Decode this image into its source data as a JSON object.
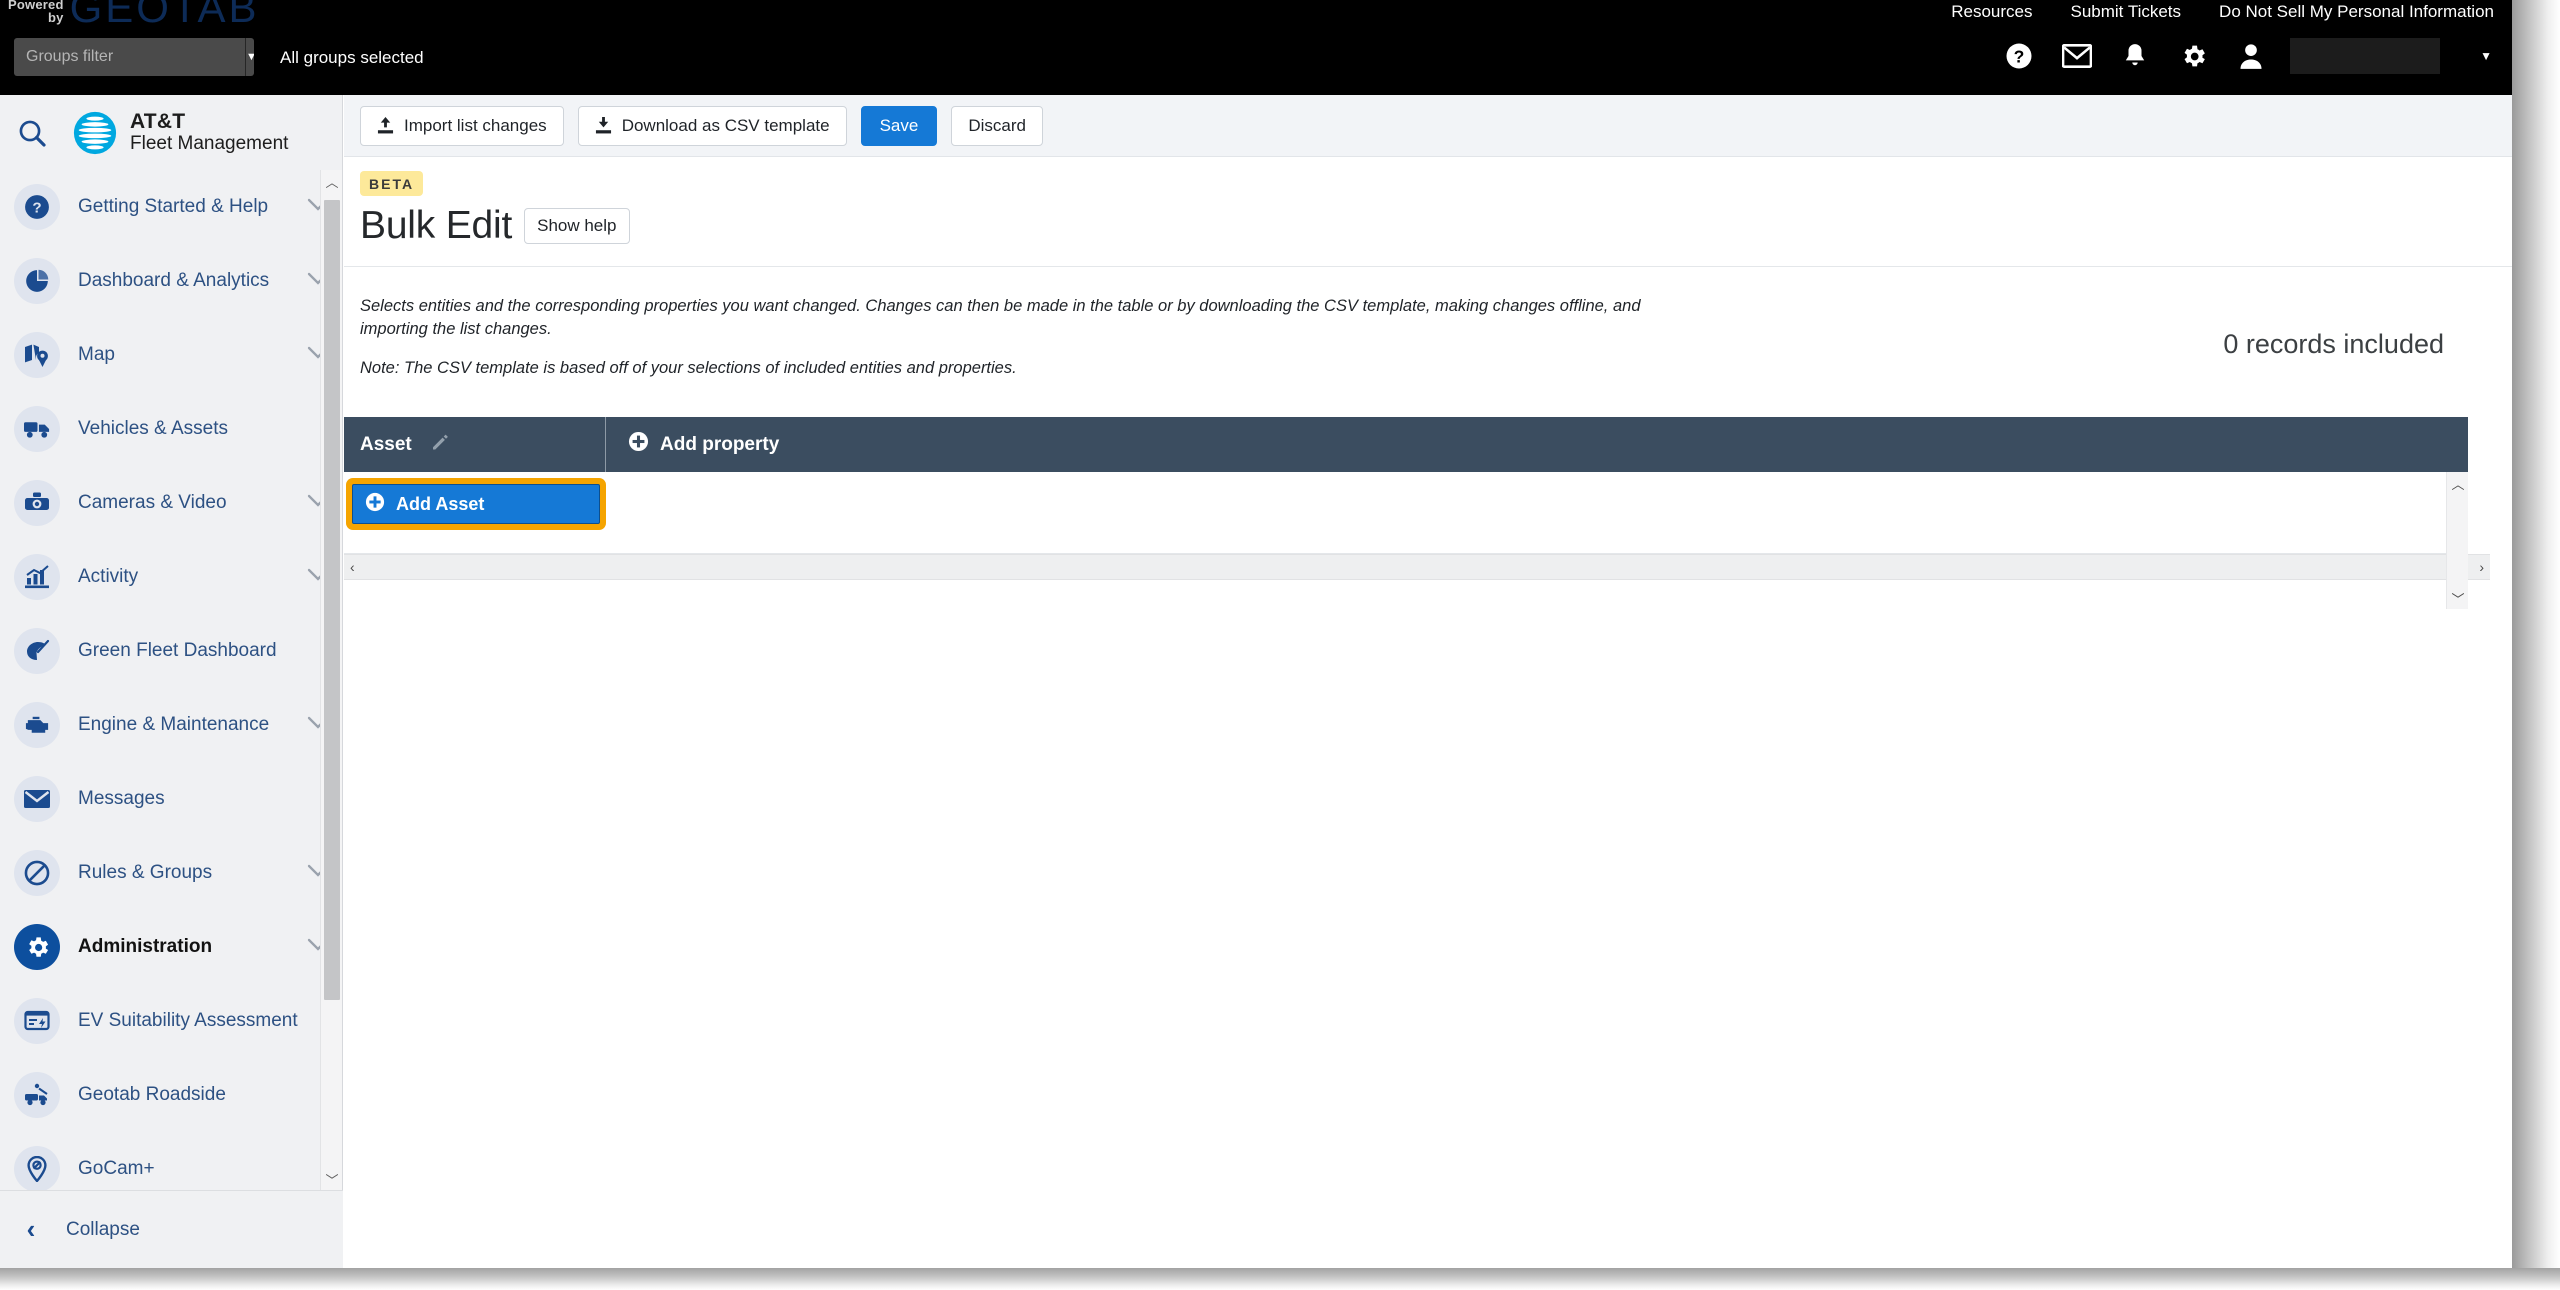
{
  "topbar": {
    "powered_by_line1": "Powered",
    "powered_by_line2": "by",
    "brand": "GEOTAB",
    "links": [
      {
        "label": "Resources",
        "name": "resources-link"
      },
      {
        "label": "Submit Tickets",
        "name": "submit-tickets-link"
      },
      {
        "label": "Do Not Sell My Personal Information",
        "name": "do-not-sell-link"
      }
    ],
    "groups_filter_placeholder": "Groups filter",
    "groups_filter_value": "",
    "all_groups_selected": "All groups selected",
    "icons": [
      "help-icon",
      "mail-icon",
      "bell-icon",
      "gear-icon",
      "user-icon"
    ],
    "user_name": ""
  },
  "sidebar": {
    "product_line1": "AT&T",
    "product_line2": "Fleet Management",
    "items": [
      {
        "label": "Getting Started & Help",
        "icon": "question-circle-icon",
        "chevron": true,
        "active": false
      },
      {
        "label": "Dashboard & Analytics",
        "icon": "pie-chart-icon",
        "chevron": true,
        "active": false
      },
      {
        "label": "Map",
        "icon": "map-pin-icon",
        "chevron": true,
        "active": false
      },
      {
        "label": "Vehicles & Assets",
        "icon": "truck-icon",
        "chevron": false,
        "active": false
      },
      {
        "label": "Cameras & Video",
        "icon": "dashcam-icon",
        "chevron": true,
        "active": false
      },
      {
        "label": "Activity",
        "icon": "bar-chart-icon",
        "chevron": true,
        "active": false
      },
      {
        "label": "Green Fleet Dashboard",
        "icon": "leaf-icon",
        "chevron": false,
        "active": false
      },
      {
        "label": "Engine & Maintenance",
        "icon": "engine-icon",
        "chevron": true,
        "active": false
      },
      {
        "label": "Messages",
        "icon": "envelope-icon",
        "chevron": false,
        "active": false
      },
      {
        "label": "Rules & Groups",
        "icon": "no-entry-icon",
        "chevron": true,
        "active": false
      },
      {
        "label": "Administration",
        "icon": "gear-icon",
        "chevron": true,
        "active": true
      },
      {
        "label": "EV Suitability Assessment",
        "icon": "ev-card-icon",
        "chevron": false,
        "active": false
      },
      {
        "label": "Geotab Roadside",
        "icon": "tow-truck-icon",
        "chevron": false,
        "active": false
      },
      {
        "label": "GoCam+",
        "icon": "camera-pin-icon",
        "chevron": false,
        "active": false
      }
    ],
    "collapse_label": "Collapse"
  },
  "toolbar": {
    "import_label": "Import list changes",
    "download_label": "Download as CSV template",
    "save_label": "Save",
    "discard_label": "Discard"
  },
  "page": {
    "badge": "BETA",
    "title": "Bulk Edit",
    "show_help_label": "Show help",
    "description": "Selects entities and the corresponding properties you want changed. Changes can then be made in the table or by downloading the CSV template, making changes offline, and importing the list changes.",
    "note": "Note: The CSV template is based off of your selections of included entities and properties.",
    "records_included": "0 records included"
  },
  "table": {
    "columns": [
      {
        "label": "Asset",
        "name": "column-asset",
        "has_edit_icon": true
      },
      {
        "label": "Add property",
        "name": "column-add-property",
        "has_add_icon": true
      }
    ],
    "add_asset_label": "Add Asset",
    "rows": []
  },
  "colors": {
    "accent_blue": "#1579d6",
    "focus_orange": "#f5a400",
    "table_header": "#3b4d60",
    "beta_yellow": "#fde99a",
    "sidebar_bg": "#f0f1f3",
    "sidebar_link": "#2d5183",
    "geotab_blue": "#0d2b57",
    "att_cyan": "#00a8e0"
  }
}
